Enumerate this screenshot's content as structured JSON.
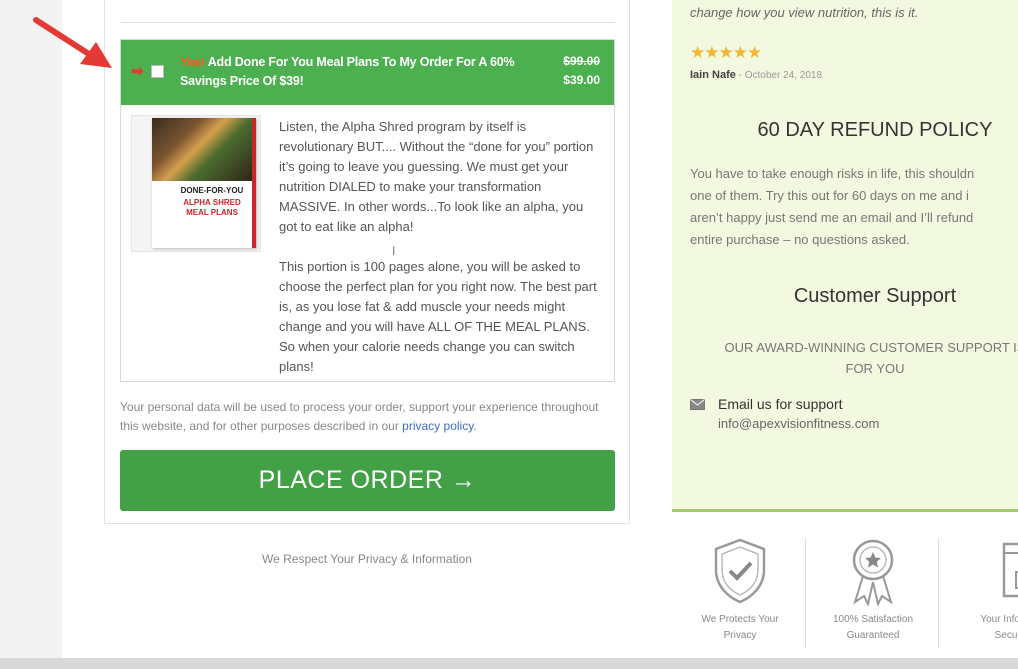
{
  "order_bump": {
    "yes_label": "Yes!",
    "title": "Add Done For You Meal Plans To My Order For A 60% Savings Price Of $39!",
    "old_price": "$99.00",
    "new_price": "$39.00",
    "product_image_lines": [
      "DONE-FOR-YOU",
      "ALPHA SHRED MEAL PLANS"
    ],
    "paragraph_1": "Listen, the Alpha Shred program by itself is revolutionary BUT.... Without the “done for you” portion it’s going to leave you guessing. We must get your nutrition DIALED to make your transformation MASSIVE. In other words...To look like an alpha, you got to eat like an alpha!",
    "paragraph_2": "This portion is 100 pages alone, you will be asked to choose the perfect plan for you right now. The best part is, as you lose fat & add muscle your needs might change and you will have ALL OF THE MEAL PLANS. So when your calorie needs change you can switch plans!"
  },
  "privacy_note": {
    "text": "Your personal data will be used to process your order, support your experience throughout this website, and for other purposes described in our ",
    "link": "privacy policy",
    "end": "."
  },
  "place_order_label": "PLACE ORDER →",
  "respect_text": "We Respect Your Privacy & Information",
  "sidebar": {
    "quote": "change how you view nutrition, this is it.",
    "stars": "★★★★★",
    "reviewer_name": "Iain Nafe",
    "review_date": " - October 24, 2018",
    "refund_title": "60 DAY REFUND POLICY",
    "refund_lines": [
      "You have to take enough risks in life, this shouldn",
      "one of them. Try this out for 60 days on me and i",
      "aren’t happy just send me an email and I’ll refund",
      "entire purchase – no questions asked."
    ],
    "support_title": "Customer Support",
    "support_lines": [
      "OUR AWARD-WINNING CUSTOMER SUPPORT IS",
      "FOR YOU"
    ],
    "email_label": "Email us for support",
    "email_value": "info@apexvisionfitness.com"
  },
  "badges": [
    {
      "line1": "We Protects Your",
      "line2": "Privacy",
      "icon": "shield-check-icon"
    },
    {
      "line1": "100% Satisfaction",
      "line2": "Guaranteed",
      "icon": "award-ribbon-icon"
    },
    {
      "line1": "Your Inform",
      "line2": "Secu",
      "icon": "secure-browser-icon"
    }
  ],
  "colors": {
    "bump_green": "#4caf50",
    "button_green": "#43a047",
    "yes_orange": "#ff5722",
    "sidebar_bg": "#f3f9e0",
    "star_gold": "#f5b731",
    "arrow_red": "#e53935"
  }
}
